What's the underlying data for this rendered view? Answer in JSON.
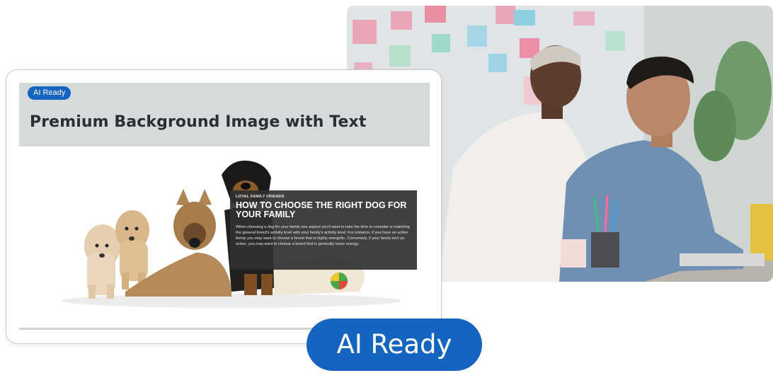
{
  "card": {
    "badge": "AI Ready",
    "title": "Premium Background Image with Text"
  },
  "article": {
    "kicker": "LOYAL FAMILY FRIENDS",
    "headline": "HOW TO CHOOSE THE RIGHT DOG FOR YOUR FAMILY",
    "body": "When choosing a dog for your family one aspect you'll want to take the time to consider is matching the general breed's activity level with your family's activity level. For instance, if you have an active family you may want to choose a breed that is highly energetic. Conversely, if your family isn't as active, you may want to choose a breed that is generally lower energy."
  },
  "badge_large": "AI Ready",
  "colors": {
    "accent": "#1565c0",
    "card_header_bg": "#d5dadb",
    "overlay_bg": "#303030"
  },
  "icons": [
    "office-photo",
    "dogs-photo"
  ]
}
